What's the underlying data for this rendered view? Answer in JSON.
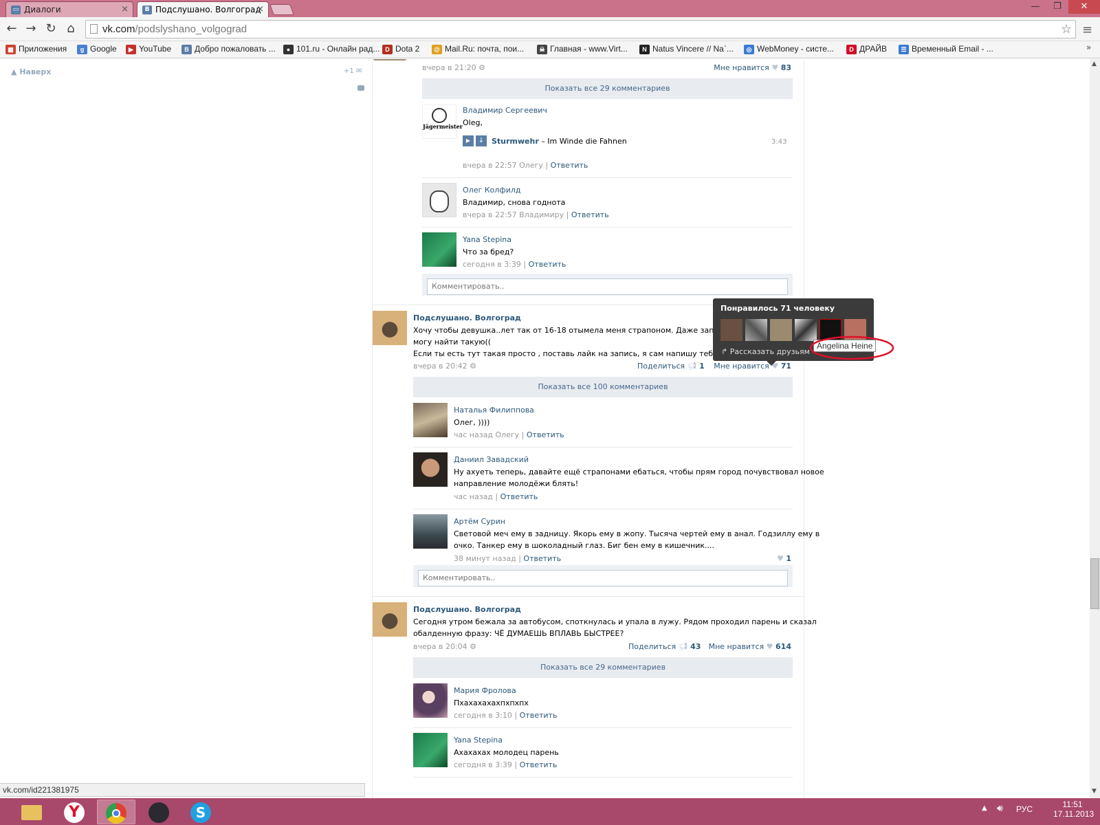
{
  "browser": {
    "tabs": [
      {
        "title": "Диалоги",
        "icon": "vk-message-icon"
      },
      {
        "title": "Подслушано. Волгоград",
        "icon": "vk-icon",
        "active": true
      }
    ],
    "url_host": "vk.com",
    "url_path": "/podslyshano_volgograd",
    "bookmarks": [
      {
        "label": "Приложения",
        "color": "#d04030",
        "glyph": "▦"
      },
      {
        "label": "Google",
        "color": "#4a7fd0",
        "glyph": "g"
      },
      {
        "label": "YouTube",
        "color": "#c4302b",
        "glyph": "▶"
      },
      {
        "label": "Добро пожаловать ...",
        "color": "#5b7ea6",
        "glyph": "В"
      },
      {
        "label": "101.ru - Онлайн рад...",
        "color": "#333333",
        "glyph": "●"
      },
      {
        "label": "Dota 2",
        "color": "#b03020",
        "glyph": "D"
      },
      {
        "label": "Mail.Ru: почта, пои...",
        "color": "#e0a020",
        "glyph": "@"
      },
      {
        "label": "Главная - www.Virt...",
        "color": "#444444",
        "glyph": "☠"
      },
      {
        "label": "Natus Vincere // Na`...",
        "color": "#222222",
        "glyph": "N"
      },
      {
        "label": "WebMoney - систе...",
        "color": "#3a7bd5",
        "glyph": "◎"
      },
      {
        "label": "ДРАЙВ",
        "color": "#d0102a",
        "glyph": "D"
      },
      {
        "label": "Временный Email - ...",
        "color": "#3a7bd5",
        "glyph": "☰"
      }
    ]
  },
  "left": {
    "up_label": "Наверх",
    "counter": "+1"
  },
  "post1": {
    "date": "вчера в 21:20",
    "likes_label": "Мне нравится",
    "likes": "83",
    "show_all": "Показать все 29 комментариев",
    "comments": [
      {
        "name": "Владимир Сергеевич",
        "text": "Oleg,",
        "track_artist": "Sturmwehr",
        "track_title": "– Im Winde die Fahnen",
        "track_time": "3:43",
        "meta": "вчера в 22:57 Олегу",
        "reply": "Ответить",
        "avatar_text": "Jägermeister"
      },
      {
        "name": "Олег Колфилд",
        "text": "Владимир, снова годнота",
        "meta": "вчера в 22:57 Владимиру",
        "reply": "Ответить"
      },
      {
        "name": "Yana Stepina",
        "text": "Что за бред?",
        "meta": "сегодня в 3:39",
        "reply": "Ответить"
      }
    ],
    "comment_placeholder": "Комментировать.."
  },
  "post2": {
    "author": "Подслушано. Волгоград",
    "text_line1": "Хочу чтобы девушка..лет так от 16-18 отымела меня страпоном. Даже заплачу ей. Н",
    "text_line2": "могу найти такую((",
    "text_line3": "Если ты есть тут такая просто , поставь лайк на запись, я сам напишу тебе. Парень 21.",
    "date": "вчера в 20:42",
    "share_label": "Поделиться",
    "shares": "1",
    "likes_label": "Мне нравится",
    "likes": "71",
    "show_all": "Показать все 100 комментариев",
    "comments": [
      {
        "name": "Наталья Филиппова",
        "text": "Олег, ))))",
        "meta": "час назад Олегу",
        "reply": "Ответить"
      },
      {
        "name": "Даниил Завадский",
        "text1": "Ну ахуеть теперь, давайте ещё страпонами ебаться, чтобы прям город почувствовал новое",
        "text2": "направление молодёжи блять!",
        "meta": "час назад",
        "reply": "Ответить"
      },
      {
        "name": "Артём Сурин",
        "text1": "Световой меч ему в задницу. Якорь ему в жопу. Тысяча чертей ему в анал. Годзиллу ему в",
        "text2": "очко. Танкер ему в шоколадный глаз. Биг бен ему в кишечник....",
        "meta": "38 минут назад",
        "reply": "Ответить",
        "likes": "1"
      }
    ],
    "comment_placeholder": "Комментировать.."
  },
  "post3": {
    "author": "Подслушано. Волгоград",
    "text_line1": "Сегодня утром бежала за автобусом, споткнулась и упала в лужу. Рядом проходил парень и сказал",
    "text_line2": "обалденную фразу: ЧЁ ДУМАЕШЬ ВПЛАВЬ БЫСТРЕЕ?",
    "date": "вчера в 20:04",
    "share_label": "Поделиться",
    "shares": "43",
    "likes_label": "Мне нравится",
    "likes": "614",
    "show_all": "Показать все 29 комментариев",
    "comments": [
      {
        "name": "Мария Фролова",
        "text": "Пхахахахахпхпхпх",
        "meta": "сегодня в 3:10",
        "reply": "Ответить"
      },
      {
        "name": "Yana Stepina",
        "text": "Ахахахах молодец парень",
        "meta": "сегодня в 3:39",
        "reply": "Ответить"
      }
    ]
  },
  "like_popup": {
    "title": "Понравилось 71 человеку",
    "share_label": "Рассказать друзьям",
    "hover_name": "Angelina Heine"
  },
  "status_url": "vk.com/id221381975",
  "taskbar": {
    "lang": "РУС",
    "time": "11:51",
    "date": "17.11.2013"
  }
}
